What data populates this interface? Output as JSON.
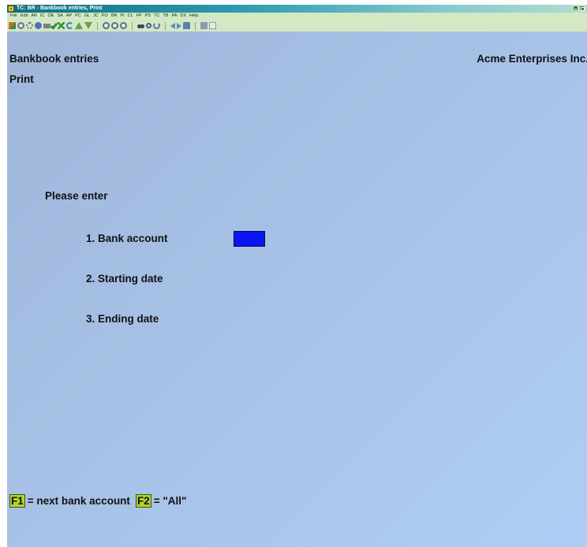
{
  "window": {
    "title": "TC: BR - Bankbook entries, Print"
  },
  "menu": [
    "File",
    "Edit",
    "AR",
    "IC",
    "OE",
    "SA",
    "AP",
    "PC",
    "GL",
    "JC",
    "PO",
    "BR",
    "PI",
    "CL",
    "FP",
    "PS",
    "TC",
    "TB",
    "PA",
    "DX",
    "Help"
  ],
  "toolbar": {
    "icons": [
      "arrow-icon",
      "stop-icon",
      "gears-icon",
      "globe-icon",
      "printer-icon",
      "checkmark-icon",
      "x-icon",
      "undo-icon",
      "up-arrow-icon",
      "down-arrow-icon",
      "circle-1-icon",
      "circle-2-icon",
      "circle-3-icon",
      "binoculars-icon",
      "magnifier-icon",
      "refresh-icon",
      "back-icon",
      "forward-icon",
      "home-icon",
      "save-icon",
      "copy-icon"
    ]
  },
  "screen": {
    "title": "Bankbook entries",
    "subtitle": "Print",
    "company": "Acme Enterprises Inc.",
    "prompt": "Please enter",
    "fields": [
      {
        "label": "1. Bank account",
        "value": ""
      },
      {
        "label": "2. Starting date",
        "value": ""
      },
      {
        "label": "3. Ending date",
        "value": ""
      }
    ]
  },
  "hotkeys": [
    {
      "key": "F1",
      "text": "= next bank account"
    },
    {
      "key": "F2",
      "text": "= \"All\""
    }
  ],
  "colors": {
    "background": "#a7c1e6",
    "input_active": "#0a16f2",
    "key_highlight": "#b3d52c",
    "chrome": "#d3e8c5"
  }
}
